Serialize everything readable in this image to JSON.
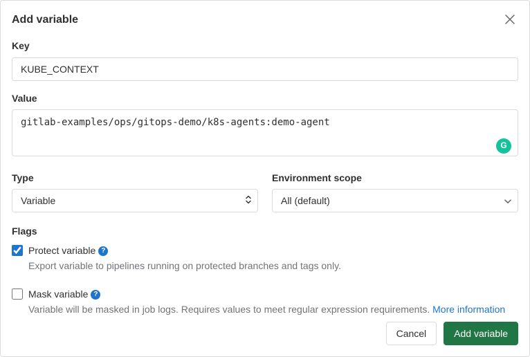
{
  "modal": {
    "title": "Add variable"
  },
  "key": {
    "label": "Key",
    "value": "KUBE_CONTEXT"
  },
  "value": {
    "label": "Value",
    "value": "gitlab-examples/ops/gitops-demo/k8s-agents:demo-agent"
  },
  "type": {
    "label": "Type",
    "selected": "Variable"
  },
  "env_scope": {
    "label": "Environment scope",
    "selected": "All (default)"
  },
  "flags": {
    "label": "Flags",
    "protect": {
      "label": "Protect variable",
      "desc": "Export variable to pipelines running on protected branches and tags only.",
      "checked": true
    },
    "mask": {
      "label": "Mask variable",
      "desc_prefix": "Variable will be masked in job logs. Requires values to meet regular expression requirements. ",
      "more_info": "More information",
      "checked": false
    }
  },
  "footer": {
    "cancel": "Cancel",
    "submit": "Add variable"
  },
  "grammarly": "G"
}
